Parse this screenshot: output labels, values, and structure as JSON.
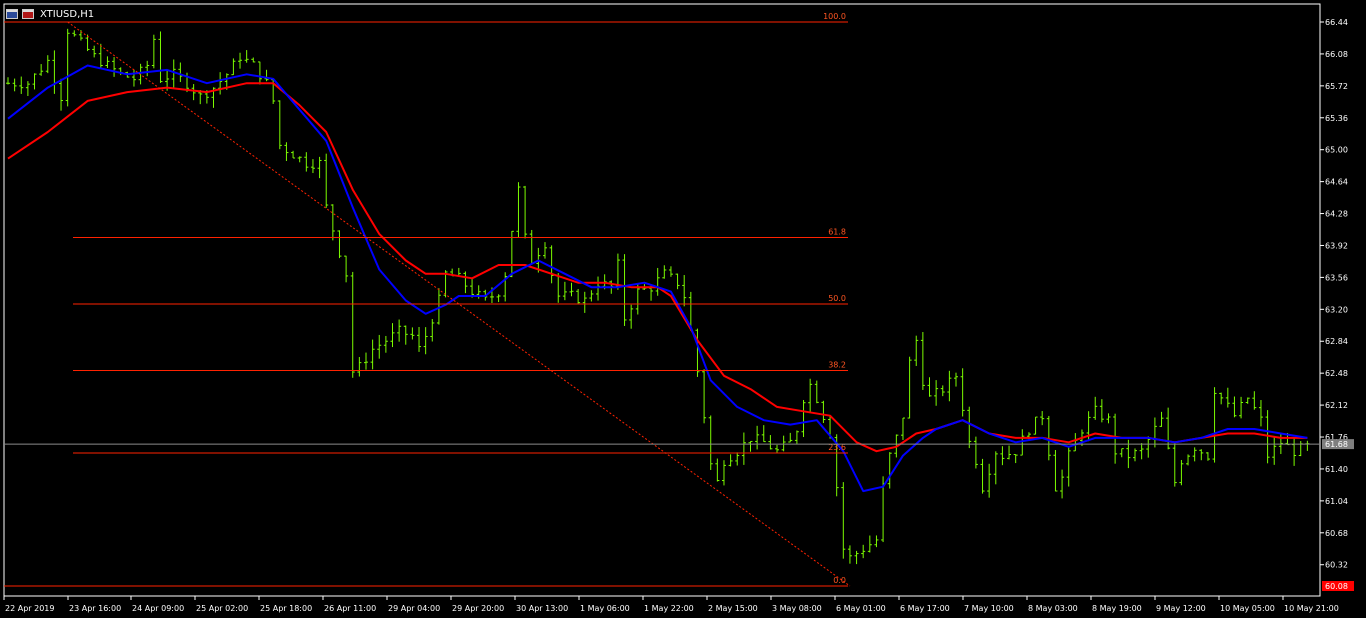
{
  "window": {
    "title": "XTIUSD,H1",
    "icon_left": "chart-window-icon",
    "icon_right": "chart-window-icon"
  },
  "colors": {
    "background": "#000000",
    "frame": "#ffffff",
    "candle": "#7cfc00",
    "ma_fast": "#0000ff",
    "ma_slow": "#ff0000",
    "fib": "#ff2200",
    "fib_label": "#ff5522",
    "price_line": "#8c8c8c",
    "price_tag_bg": "#7f7f7f",
    "low_tag_bg": "#ff0000"
  },
  "chart_data": {
    "type": "candlestick",
    "symbol": "XTIUSD",
    "timeframe": "H1",
    "ylim": [
      60.08,
      66.5
    ],
    "y_ticks": [
      "66.44",
      "66.08",
      "65.72",
      "65.36",
      "65.00",
      "64.64",
      "64.28",
      "63.92",
      "63.56",
      "63.20",
      "62.84",
      "62.48",
      "62.12",
      "61.76",
      "61.40",
      "61.04",
      "60.68",
      "60.32"
    ],
    "x_ticks": [
      "22 Apr 2019",
      "23 Apr 16:00",
      "24 Apr 09:00",
      "25 Apr 02:00",
      "25 Apr 18:00",
      "26 Apr 11:00",
      "29 Apr 04:00",
      "29 Apr 20:00",
      "30 Apr 13:00",
      "1 May 06:00",
      "1 May 22:00",
      "2 May 15:00",
      "3 May 08:00",
      "6 May 01:00",
      "6 May 17:00",
      "7 May 10:00",
      "8 May 03:00",
      "8 May 19:00",
      "9 May 12:00",
      "10 May 05:00",
      "10 May 21:00"
    ],
    "current_price": "61.68",
    "low_marker": "60.08",
    "price_path": [
      [
        0,
        65.75
      ],
      [
        3,
        65.75
      ],
      [
        6,
        66.0
      ],
      [
        8,
        65.6
      ],
      [
        9,
        66.35
      ],
      [
        11,
        66.2
      ],
      [
        13,
        66.05
      ],
      [
        15,
        65.95
      ],
      [
        17,
        65.85
      ],
      [
        19,
        65.8
      ],
      [
        21,
        65.95
      ],
      [
        22,
        66.25
      ],
      [
        23,
        65.8
      ],
      [
        25,
        65.85
      ],
      [
        27,
        65.75
      ],
      [
        29,
        65.6
      ],
      [
        31,
        65.7
      ],
      [
        33,
        65.85
      ],
      [
        35,
        66.05
      ],
      [
        37,
        65.95
      ],
      [
        39,
        65.75
      ],
      [
        40,
        65.55
      ],
      [
        41,
        65.05
      ],
      [
        43,
        64.95
      ],
      [
        45,
        64.85
      ],
      [
        47,
        64.85
      ],
      [
        48,
        64.35
      ],
      [
        49,
        64.1
      ],
      [
        50,
        63.85
      ],
      [
        51,
        63.6
      ],
      [
        52,
        62.5
      ],
      [
        53,
        62.55
      ],
      [
        55,
        62.75
      ],
      [
        57,
        62.85
      ],
      [
        59,
        62.95
      ],
      [
        61,
        62.9
      ],
      [
        62,
        62.75
      ],
      [
        63,
        62.9
      ],
      [
        64,
        63.1
      ],
      [
        65,
        63.3
      ],
      [
        66,
        63.6
      ],
      [
        68,
        63.55
      ],
      [
        70,
        63.4
      ],
      [
        72,
        63.3
      ],
      [
        74,
        63.4
      ],
      [
        75,
        63.6
      ],
      [
        76,
        64.1
      ],
      [
        77,
        64.55
      ],
      [
        78,
        64.0
      ],
      [
        79,
        63.75
      ],
      [
        80,
        63.85
      ],
      [
        81,
        63.95
      ],
      [
        82,
        63.6
      ],
      [
        83,
        63.35
      ],
      [
        85,
        63.35
      ],
      [
        87,
        63.3
      ],
      [
        89,
        63.5
      ],
      [
        91,
        63.45
      ],
      [
        92,
        63.7
      ],
      [
        93,
        63.1
      ],
      [
        95,
        63.4
      ],
      [
        97,
        63.45
      ],
      [
        99,
        63.6
      ],
      [
        101,
        63.5
      ],
      [
        102,
        63.35
      ],
      [
        103,
        62.95
      ],
      [
        104,
        62.5
      ],
      [
        105,
        62.0
      ],
      [
        106,
        61.45
      ],
      [
        107,
        61.25
      ],
      [
        108,
        61.5
      ],
      [
        110,
        61.6
      ],
      [
        112,
        61.75
      ],
      [
        114,
        61.7
      ],
      [
        116,
        61.6
      ],
      [
        118,
        61.7
      ],
      [
        119,
        61.85
      ],
      [
        120,
        62.2
      ],
      [
        121,
        62.35
      ],
      [
        122,
        62.2
      ],
      [
        123,
        62.0
      ],
      [
        124,
        61.8
      ],
      [
        125,
        61.2
      ],
      [
        126,
        60.5
      ],
      [
        127,
        60.4
      ],
      [
        129,
        60.5
      ],
      [
        131,
        60.6
      ],
      [
        132,
        61.2
      ],
      [
        133,
        61.55
      ],
      [
        134,
        61.75
      ],
      [
        135,
        62.0
      ],
      [
        136,
        62.6
      ],
      [
        137,
        62.85
      ],
      [
        138,
        62.4
      ],
      [
        139,
        62.2
      ],
      [
        141,
        62.3
      ],
      [
        143,
        62.45
      ],
      [
        144,
        62.1
      ],
      [
        145,
        61.7
      ],
      [
        146,
        61.5
      ],
      [
        147,
        61.2
      ],
      [
        148,
        61.4
      ],
      [
        149,
        61.6
      ],
      [
        150,
        61.55
      ],
      [
        152,
        61.6
      ],
      [
        154,
        61.85
      ],
      [
        156,
        62.0
      ],
      [
        157,
        61.6
      ],
      [
        158,
        61.2
      ],
      [
        159,
        61.3
      ],
      [
        160,
        61.55
      ],
      [
        162,
        61.85
      ],
      [
        164,
        62.05
      ],
      [
        166,
        61.95
      ],
      [
        167,
        61.6
      ],
      [
        169,
        61.55
      ],
      [
        171,
        61.6
      ],
      [
        173,
        61.85
      ],
      [
        174,
        61.95
      ],
      [
        175,
        61.6
      ],
      [
        176,
        61.25
      ],
      [
        177,
        61.5
      ],
      [
        179,
        61.65
      ],
      [
        181,
        61.55
      ],
      [
        182,
        62.3
      ],
      [
        183,
        62.2
      ],
      [
        185,
        62.0
      ],
      [
        187,
        62.2
      ],
      [
        189,
        61.95
      ],
      [
        190,
        61.55
      ],
      [
        192,
        61.7
      ],
      [
        194,
        61.6
      ],
      [
        196,
        61.65
      ]
    ],
    "ma_fast": [
      [
        0,
        65.35
      ],
      [
        6,
        65.7
      ],
      [
        12,
        65.95
      ],
      [
        18,
        65.85
      ],
      [
        24,
        65.9
      ],
      [
        30,
        65.75
      ],
      [
        36,
        65.85
      ],
      [
        40,
        65.8
      ],
      [
        44,
        65.45
      ],
      [
        48,
        65.1
      ],
      [
        52,
        64.35
      ],
      [
        56,
        63.65
      ],
      [
        60,
        63.3
      ],
      [
        63,
        63.15
      ],
      [
        66,
        63.25
      ],
      [
        68,
        63.35
      ],
      [
        72,
        63.35
      ],
      [
        76,
        63.6
      ],
      [
        80,
        63.75
      ],
      [
        84,
        63.6
      ],
      [
        88,
        63.45
      ],
      [
        92,
        63.45
      ],
      [
        96,
        63.5
      ],
      [
        100,
        63.4
      ],
      [
        103,
        63.0
      ],
      [
        106,
        62.4
      ],
      [
        110,
        62.1
      ],
      [
        114,
        61.95
      ],
      [
        118,
        61.9
      ],
      [
        122,
        61.95
      ],
      [
        126,
        61.6
      ],
      [
        129,
        61.15
      ],
      [
        132,
        61.2
      ],
      [
        135,
        61.55
      ],
      [
        138,
        61.75
      ],
      [
        140,
        61.85
      ],
      [
        144,
        61.95
      ],
      [
        148,
        61.8
      ],
      [
        152,
        61.7
      ],
      [
        156,
        61.75
      ],
      [
        160,
        61.65
      ],
      [
        164,
        61.75
      ],
      [
        168,
        61.75
      ],
      [
        172,
        61.75
      ],
      [
        176,
        61.7
      ],
      [
        180,
        61.75
      ],
      [
        184,
        61.85
      ],
      [
        188,
        61.85
      ],
      [
        192,
        61.8
      ],
      [
        196,
        61.75
      ]
    ],
    "ma_slow": [
      [
        0,
        64.9
      ],
      [
        6,
        65.2
      ],
      [
        12,
        65.55
      ],
      [
        18,
        65.65
      ],
      [
        24,
        65.7
      ],
      [
        30,
        65.65
      ],
      [
        36,
        65.75
      ],
      [
        40,
        65.75
      ],
      [
        44,
        65.5
      ],
      [
        48,
        65.2
      ],
      [
        52,
        64.55
      ],
      [
        56,
        64.05
      ],
      [
        60,
        63.75
      ],
      [
        63,
        63.6
      ],
      [
        66,
        63.6
      ],
      [
        70,
        63.55
      ],
      [
        74,
        63.7
      ],
      [
        78,
        63.7
      ],
      [
        82,
        63.6
      ],
      [
        86,
        63.5
      ],
      [
        90,
        63.5
      ],
      [
        94,
        63.45
      ],
      [
        98,
        63.45
      ],
      [
        100,
        63.35
      ],
      [
        104,
        62.85
      ],
      [
        108,
        62.45
      ],
      [
        112,
        62.3
      ],
      [
        116,
        62.1
      ],
      [
        120,
        62.05
      ],
      [
        124,
        62.0
      ],
      [
        128,
        61.7
      ],
      [
        131,
        61.6
      ],
      [
        134,
        61.65
      ],
      [
        137,
        61.8
      ],
      [
        140,
        61.85
      ],
      [
        144,
        61.95
      ],
      [
        148,
        61.8
      ],
      [
        152,
        61.75
      ],
      [
        156,
        61.75
      ],
      [
        160,
        61.7
      ],
      [
        164,
        61.8
      ],
      [
        168,
        61.75
      ],
      [
        172,
        61.75
      ],
      [
        176,
        61.7
      ],
      [
        180,
        61.75
      ],
      [
        184,
        61.8
      ],
      [
        188,
        61.8
      ],
      [
        192,
        61.75
      ],
      [
        196,
        61.75
      ]
    ],
    "fibonacci": {
      "high": 66.44,
      "low": 60.08,
      "levels": [
        {
          "label": "100.0",
          "price": 66.44
        },
        {
          "label": "61.8",
          "price": 64.01
        },
        {
          "label": "50.0",
          "price": 63.26
        },
        {
          "label": "38.2",
          "price": 62.51
        },
        {
          "label": "23.6",
          "price": 61.58
        },
        {
          "label": "0.0",
          "price": 60.08
        }
      ],
      "trend_start": [
        9,
        66.44
      ],
      "trend_end": [
        127,
        60.08
      ]
    }
  }
}
